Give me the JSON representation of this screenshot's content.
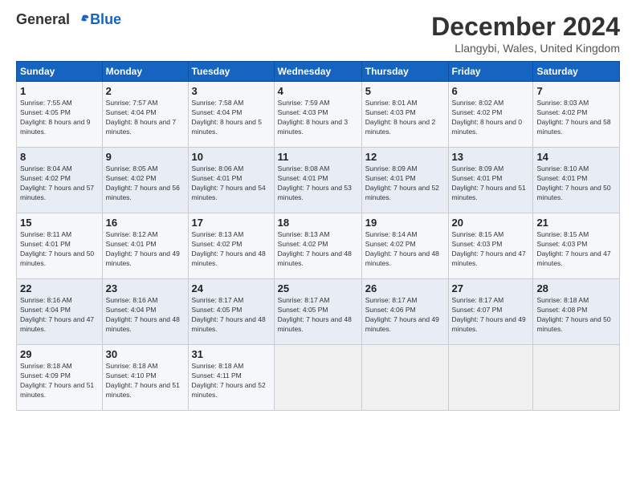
{
  "logo": {
    "line1": "General",
    "line2": "Blue"
  },
  "title": "December 2024",
  "location": "Llangybi, Wales, United Kingdom",
  "headers": [
    "Sunday",
    "Monday",
    "Tuesday",
    "Wednesday",
    "Thursday",
    "Friday",
    "Saturday"
  ],
  "weeks": [
    [
      {
        "day": "1",
        "sunrise": "7:55 AM",
        "sunset": "4:05 PM",
        "daylight": "8 hours and 9 minutes."
      },
      {
        "day": "2",
        "sunrise": "7:57 AM",
        "sunset": "4:04 PM",
        "daylight": "8 hours and 7 minutes."
      },
      {
        "day": "3",
        "sunrise": "7:58 AM",
        "sunset": "4:04 PM",
        "daylight": "8 hours and 5 minutes."
      },
      {
        "day": "4",
        "sunrise": "7:59 AM",
        "sunset": "4:03 PM",
        "daylight": "8 hours and 3 minutes."
      },
      {
        "day": "5",
        "sunrise": "8:01 AM",
        "sunset": "4:03 PM",
        "daylight": "8 hours and 2 minutes."
      },
      {
        "day": "6",
        "sunrise": "8:02 AM",
        "sunset": "4:02 PM",
        "daylight": "8 hours and 0 minutes."
      },
      {
        "day": "7",
        "sunrise": "8:03 AM",
        "sunset": "4:02 PM",
        "daylight": "7 hours and 58 minutes."
      }
    ],
    [
      {
        "day": "8",
        "sunrise": "8:04 AM",
        "sunset": "4:02 PM",
        "daylight": "7 hours and 57 minutes."
      },
      {
        "day": "9",
        "sunrise": "8:05 AM",
        "sunset": "4:02 PM",
        "daylight": "7 hours and 56 minutes."
      },
      {
        "day": "10",
        "sunrise": "8:06 AM",
        "sunset": "4:01 PM",
        "daylight": "7 hours and 54 minutes."
      },
      {
        "day": "11",
        "sunrise": "8:08 AM",
        "sunset": "4:01 PM",
        "daylight": "7 hours and 53 minutes."
      },
      {
        "day": "12",
        "sunrise": "8:09 AM",
        "sunset": "4:01 PM",
        "daylight": "7 hours and 52 minutes."
      },
      {
        "day": "13",
        "sunrise": "8:09 AM",
        "sunset": "4:01 PM",
        "daylight": "7 hours and 51 minutes."
      },
      {
        "day": "14",
        "sunrise": "8:10 AM",
        "sunset": "4:01 PM",
        "daylight": "7 hours and 50 minutes."
      }
    ],
    [
      {
        "day": "15",
        "sunrise": "8:11 AM",
        "sunset": "4:01 PM",
        "daylight": "7 hours and 50 minutes."
      },
      {
        "day": "16",
        "sunrise": "8:12 AM",
        "sunset": "4:01 PM",
        "daylight": "7 hours and 49 minutes."
      },
      {
        "day": "17",
        "sunrise": "8:13 AM",
        "sunset": "4:02 PM",
        "daylight": "7 hours and 48 minutes."
      },
      {
        "day": "18",
        "sunrise": "8:13 AM",
        "sunset": "4:02 PM",
        "daylight": "7 hours and 48 minutes."
      },
      {
        "day": "19",
        "sunrise": "8:14 AM",
        "sunset": "4:02 PM",
        "daylight": "7 hours and 48 minutes."
      },
      {
        "day": "20",
        "sunrise": "8:15 AM",
        "sunset": "4:03 PM",
        "daylight": "7 hours and 47 minutes."
      },
      {
        "day": "21",
        "sunrise": "8:15 AM",
        "sunset": "4:03 PM",
        "daylight": "7 hours and 47 minutes."
      }
    ],
    [
      {
        "day": "22",
        "sunrise": "8:16 AM",
        "sunset": "4:04 PM",
        "daylight": "7 hours and 47 minutes."
      },
      {
        "day": "23",
        "sunrise": "8:16 AM",
        "sunset": "4:04 PM",
        "daylight": "7 hours and 48 minutes."
      },
      {
        "day": "24",
        "sunrise": "8:17 AM",
        "sunset": "4:05 PM",
        "daylight": "7 hours and 48 minutes."
      },
      {
        "day": "25",
        "sunrise": "8:17 AM",
        "sunset": "4:05 PM",
        "daylight": "7 hours and 48 minutes."
      },
      {
        "day": "26",
        "sunrise": "8:17 AM",
        "sunset": "4:06 PM",
        "daylight": "7 hours and 49 minutes."
      },
      {
        "day": "27",
        "sunrise": "8:17 AM",
        "sunset": "4:07 PM",
        "daylight": "7 hours and 49 minutes."
      },
      {
        "day": "28",
        "sunrise": "8:18 AM",
        "sunset": "4:08 PM",
        "daylight": "7 hours and 50 minutes."
      }
    ],
    [
      {
        "day": "29",
        "sunrise": "8:18 AM",
        "sunset": "4:09 PM",
        "daylight": "7 hours and 51 minutes."
      },
      {
        "day": "30",
        "sunrise": "8:18 AM",
        "sunset": "4:10 PM",
        "daylight": "7 hours and 51 minutes."
      },
      {
        "day": "31",
        "sunrise": "8:18 AM",
        "sunset": "4:11 PM",
        "daylight": "7 hours and 52 minutes."
      },
      null,
      null,
      null,
      null
    ]
  ]
}
